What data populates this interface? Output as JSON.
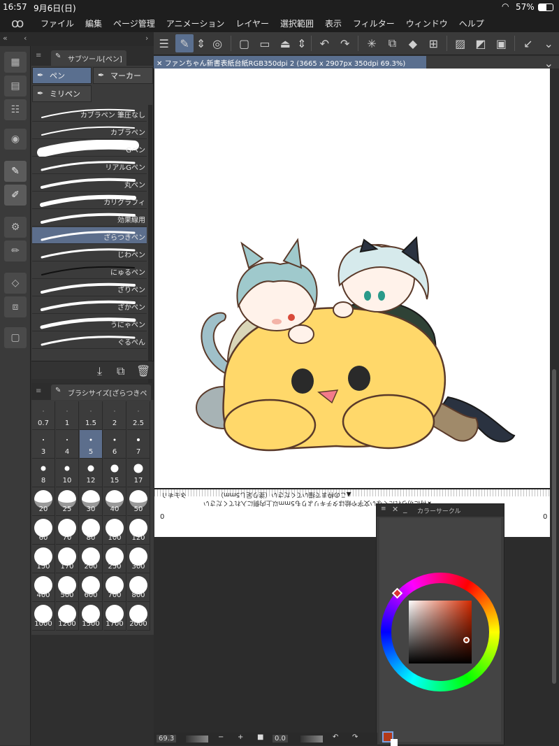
{
  "status": {
    "time": "16:57",
    "date": "9月6日(日)",
    "battery": "57%"
  },
  "menu": [
    "ファイル",
    "編集",
    "ページ管理",
    "アニメーション",
    "レイヤー",
    "選択範囲",
    "表示",
    "フィルター",
    "ウィンドウ",
    "ヘルプ"
  ],
  "subtool": {
    "title": "サブツール[ペン]",
    "groups": [
      "ペン",
      "マーカー",
      "ミリペン"
    ],
    "brushes": [
      "カブラペン 筆圧なし",
      "カブラペン",
      "Gペン",
      "リアルGペン",
      "丸ペン",
      "カリグラフィ",
      "効果線用",
      "ざらつきペン",
      "じわペン",
      "にゅるペン",
      "ざりペン",
      "ざかペン",
      "うにゃペン",
      "ぐるぺん"
    ],
    "selected": "ざらつきペン"
  },
  "brushsize": {
    "title": "ブラシサイズ[ざらつきペ",
    "sizes": [
      "0.7",
      "1",
      "1.5",
      "2",
      "2.5",
      "3",
      "4",
      "5",
      "6",
      "7",
      "8",
      "10",
      "12",
      "15",
      "17",
      "20",
      "25",
      "30",
      "40",
      "50",
      "60",
      "70",
      "80",
      "100",
      "120",
      "150",
      "170",
      "200",
      "250",
      "300",
      "400",
      "500",
      "600",
      "700",
      "800",
      "1000",
      "1200",
      "1500",
      "1700",
      "2000"
    ],
    "selected": "5"
  },
  "document": {
    "tab": "ファンちゃん新書表紙台紙RGB350dpi 2 (3665 x 2907px 350dpi 69.3%)"
  },
  "ruler": {
    "line1": "▲この枠まで描いてください（塗り足し5mm）",
    "line2": "★特に切られたくない文字や絵はタチキリよりも5mm以上内側に入れてください",
    "left_label": "タチキリ",
    "zero_left": "0",
    "zero_right": "0"
  },
  "colorpanel": {
    "title": "カラーサークル",
    "main_color": "#b33a1a"
  },
  "bottom": {
    "zoom": "69.3",
    "angle": "0.0"
  }
}
